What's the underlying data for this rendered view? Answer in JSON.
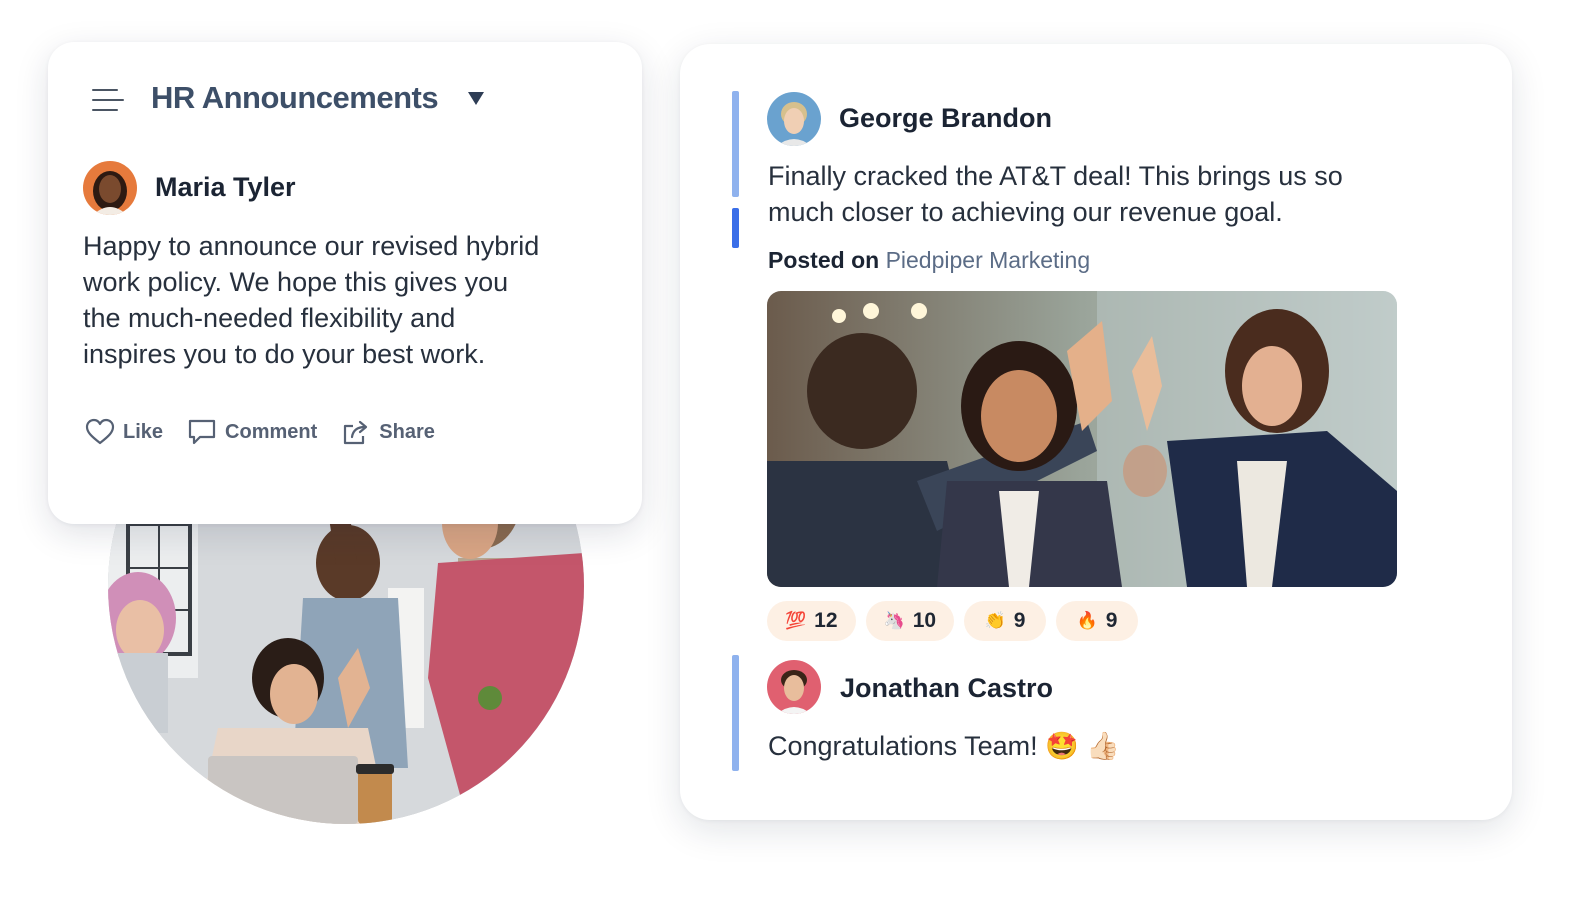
{
  "hr_card": {
    "channel_title": "HR Announcements",
    "post": {
      "author": "Maria Tyler",
      "lines": [
        "Happy to announce our revised hybrid",
        "work policy. We hope this gives you",
        "the much-needed flexibility and",
        "inspires you to do your best work."
      ]
    },
    "actions": {
      "like": "Like",
      "comment": "Comment",
      "share": "Share"
    }
  },
  "feed_card": {
    "post": {
      "author": "George Brandon",
      "lines": [
        "Finally cracked the AT&T deal! This brings us so",
        "much closer to achieving our revenue goal."
      ],
      "posted_label": "Posted on",
      "posted_channel": "Piedpiper Marketing",
      "reactions": [
        {
          "emoji": "💯",
          "count": "12"
        },
        {
          "emoji": "🦄",
          "count": "10"
        },
        {
          "emoji": "👏",
          "count": "9"
        },
        {
          "emoji": "🔥",
          "count": "9"
        }
      ]
    },
    "reply": {
      "author": "Jonathan Castro",
      "text": "Congratulations Team! 🤩 👍🏻"
    }
  },
  "colors": {
    "accent_bar_light": "#8fb2ee",
    "accent_bar_dark": "#3a6ee8",
    "reaction_bg": "#fdf0e4",
    "channel_title": "#3d4f68"
  }
}
